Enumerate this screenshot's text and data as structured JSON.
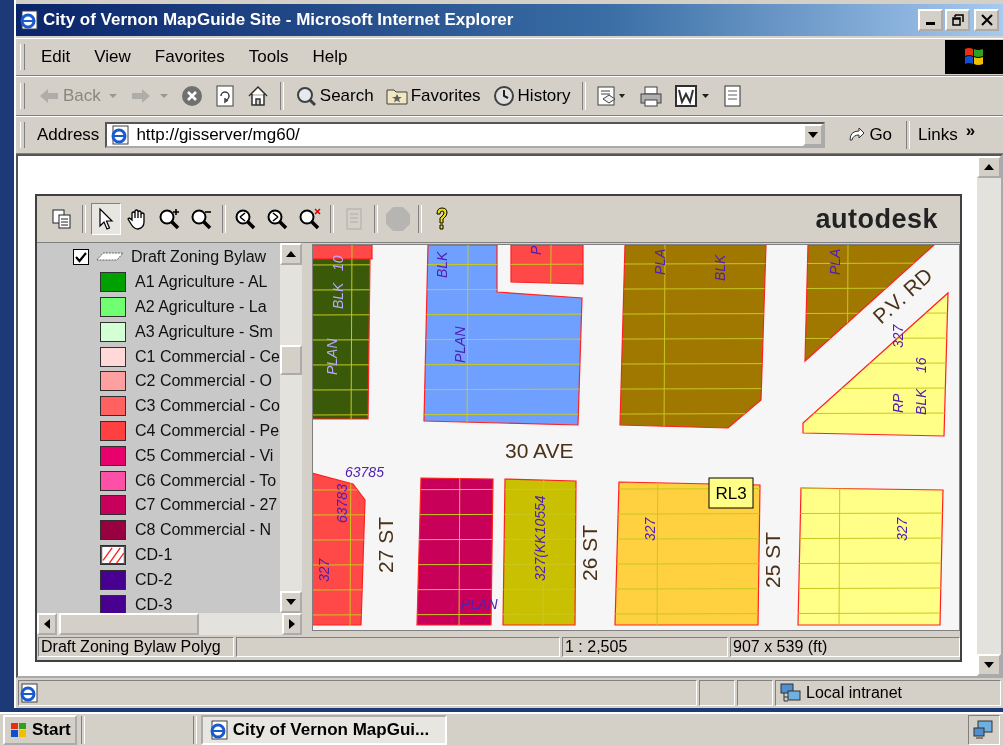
{
  "window": {
    "title": "City of Vernon MapGuide Site - Microsoft Internet Explorer"
  },
  "menu": [
    "Edit",
    "View",
    "Favorites",
    "Tools",
    "Help"
  ],
  "toolbar": [
    {
      "kind": "back",
      "label": "Back",
      "disabled": true
    },
    {
      "kind": "forward",
      "disabled": true
    },
    {
      "kind": "stop",
      "disabled": false
    },
    {
      "kind": "refresh",
      "disabled": false
    },
    {
      "kind": "home",
      "disabled": false
    },
    {
      "kind": "search",
      "label": "Search",
      "disabled": false
    },
    {
      "kind": "favorites",
      "label": "Favorites",
      "disabled": false
    },
    {
      "kind": "history",
      "label": "History",
      "disabled": false
    },
    {
      "kind": "mail",
      "disabled": false
    },
    {
      "kind": "print",
      "disabled": false
    },
    {
      "kind": "word",
      "disabled": false
    },
    {
      "kind": "discuss",
      "disabled": false
    }
  ],
  "address": {
    "label": "Address",
    "value": "http://gisserver/mg60/",
    "go": "Go",
    "links": "Links",
    "more": "»"
  },
  "viewer": {
    "logo": "autodesk",
    "tools": [
      {
        "kind": "copy",
        "selected": false,
        "disabled": false
      },
      {
        "kind": "select",
        "selected": true,
        "disabled": false
      },
      {
        "kind": "pan",
        "selected": false,
        "disabled": false
      },
      {
        "kind": "zoom-in",
        "selected": false,
        "disabled": false
      },
      {
        "kind": "zoom-out",
        "selected": false,
        "disabled": false
      },
      {
        "kind": "zoom-previous",
        "selected": false,
        "disabled": false
      },
      {
        "kind": "zoom-next",
        "selected": false,
        "disabled": false
      },
      {
        "kind": "zoom-clear",
        "selected": false,
        "disabled": false
      },
      {
        "kind": "report",
        "selected": false,
        "disabled": true
      },
      {
        "kind": "stop",
        "selected": false,
        "disabled": true
      },
      {
        "kind": "help",
        "selected": false,
        "disabled": false
      }
    ],
    "legend": {
      "layer": {
        "label": "Draft Zoning Bylaw",
        "checked": true
      },
      "items": [
        {
          "label": "A1 Agriculture - AL",
          "kind": "fill",
          "color": "#00a000"
        },
        {
          "label": "A2 Agriculture - La",
          "kind": "fill",
          "color": "#70ff70"
        },
        {
          "label": "A3 Agriculture - Sm",
          "kind": "fill",
          "color": "#d4ffd4"
        },
        {
          "label": "C1 Commercial - Ce",
          "kind": "fill",
          "color": "#ffd8d8"
        },
        {
          "label": "C2 Commercial - O",
          "kind": "fill",
          "color": "#ffa0a0"
        },
        {
          "label": "C3 Commercial - Co",
          "kind": "fill",
          "color": "#ff6060"
        },
        {
          "label": "C4 Commercial - Pe",
          "kind": "fill",
          "color": "#ff4040"
        },
        {
          "label": "C5 Commercial - Vi",
          "kind": "fill",
          "color": "#e8006c"
        },
        {
          "label": "C6 Commercial - To",
          "kind": "fill",
          "color": "#ff50a8"
        },
        {
          "label": "C7 Commercial - 27",
          "kind": "fill",
          "color": "#c8005c"
        },
        {
          "label": "C8 Commercial - N",
          "kind": "fill",
          "color": "#980040"
        },
        {
          "label": "CD-1",
          "kind": "hatch",
          "color": "#ff2020"
        },
        {
          "label": "CD-2",
          "kind": "fill",
          "color": "#480090"
        },
        {
          "label": "CD-3",
          "kind": "fill",
          "color": "#480090"
        }
      ]
    },
    "map": {
      "parcels": [
        {
          "color": "#ff4848"
        },
        {
          "color": "#3a5a0a"
        },
        {
          "color": "#70a0ff"
        },
        {
          "color": "#ff4848"
        },
        {
          "color": "#a07800"
        },
        {
          "color": "#a07800"
        },
        {
          "color": "#ffff88"
        },
        {
          "color": "#ff4848"
        },
        {
          "color": "#c8005a"
        },
        {
          "color": "#c8c000"
        },
        {
          "color": "#ffd040"
        },
        {
          "color": "#ffff88"
        }
      ],
      "labels": [
        {
          "text": "10",
          "kind": "lot"
        },
        {
          "text": "BLK",
          "kind": "lot"
        },
        {
          "text": "PLAN",
          "kind": "lot"
        },
        {
          "text": "BLK",
          "kind": "lot"
        },
        {
          "text": "PLAN",
          "kind": "lot"
        },
        {
          "text": "P",
          "kind": "lot"
        },
        {
          "text": "PLA",
          "kind": "lot"
        },
        {
          "text": "BLK",
          "kind": "lot"
        },
        {
          "text": "PLA",
          "kind": "lot"
        },
        {
          "text": "P.V. RD",
          "kind": "street"
        },
        {
          "text": "327",
          "kind": "lot"
        },
        {
          "text": "16",
          "kind": "lot"
        },
        {
          "text": "RP",
          "kind": "lot"
        },
        {
          "text": "BLK",
          "kind": "lot"
        },
        {
          "text": "30 AVE",
          "kind": "street"
        },
        {
          "text": "63785",
          "kind": "lot"
        },
        {
          "text": "63783",
          "kind": "lot"
        },
        {
          "text": "327",
          "kind": "lot"
        },
        {
          "text": "27 ST",
          "kind": "street"
        },
        {
          "text": "PLAN",
          "kind": "lot"
        },
        {
          "text": "327(KK10554",
          "kind": "lot"
        },
        {
          "text": "26 ST",
          "kind": "street"
        },
        {
          "text": "327",
          "kind": "lot"
        },
        {
          "text": "RL3",
          "kind": "tag"
        },
        {
          "text": "25 ST",
          "kind": "street"
        },
        {
          "text": "327",
          "kind": "lot"
        }
      ]
    },
    "status": {
      "layer": "Draft Zoning Bylaw Polyg",
      "scale": "1 : 2,505",
      "size": "907 x 539 (ft)"
    }
  },
  "status_bar": {
    "zone": "Local intranet"
  },
  "taskbar": {
    "start": "Start",
    "tasks": [
      {
        "label": "City of Vernon MapGui...",
        "selected": true
      }
    ]
  }
}
